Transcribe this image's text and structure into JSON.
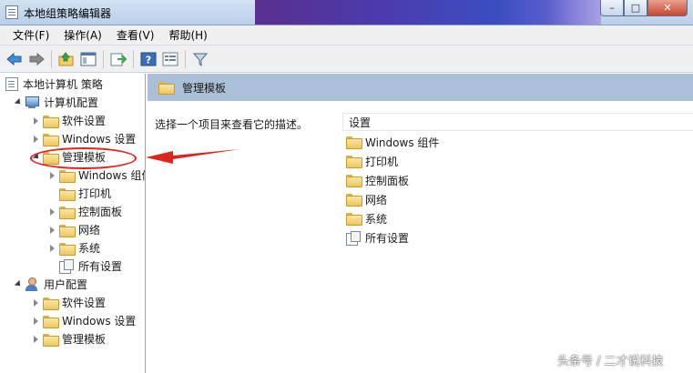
{
  "window": {
    "title": "本地组策略编辑器",
    "buttons": {
      "minimize": "–",
      "maximize": "□",
      "close": "✕"
    }
  },
  "menu": [
    {
      "label": "文件(F)"
    },
    {
      "label": "操作(A)"
    },
    {
      "label": "查看(V)"
    },
    {
      "label": "帮助(H)"
    }
  ],
  "toolbar": {
    "icons": [
      "back-arrow-icon",
      "forward-arrow-icon",
      "up-folder-icon",
      "show-hide-tree-icon",
      "export-list-icon",
      "help-icon",
      "properties-icon",
      "filter-icon"
    ]
  },
  "tree": {
    "root": "本地计算机 策略",
    "computer_config": "计算机配置",
    "software_settings": "软件设置",
    "windows_settings": "Windows 设置",
    "admin_templates": "管理模板",
    "windows_components": "Windows 组件",
    "printers": "打印机",
    "control_panel": "控制面板",
    "network": "网络",
    "system": "系统",
    "all_settings": "所有设置",
    "user_config": "用户配置",
    "user_software_settings": "软件设置",
    "user_windows_settings": "Windows 设置",
    "user_admin_templates": "管理模板"
  },
  "right_pane": {
    "header_title": "管理模板",
    "description": "选择一个项目来查看它的描述。",
    "column_header": "设置",
    "items": [
      {
        "label": "Windows 组件"
      },
      {
        "label": "打印机"
      },
      {
        "label": "控制面板"
      },
      {
        "label": "网络"
      },
      {
        "label": "系统"
      },
      {
        "label": "所有设置"
      }
    ]
  },
  "annotation": {
    "color": "#e0231d"
  },
  "watermark": "头条号 / 二才说科技"
}
